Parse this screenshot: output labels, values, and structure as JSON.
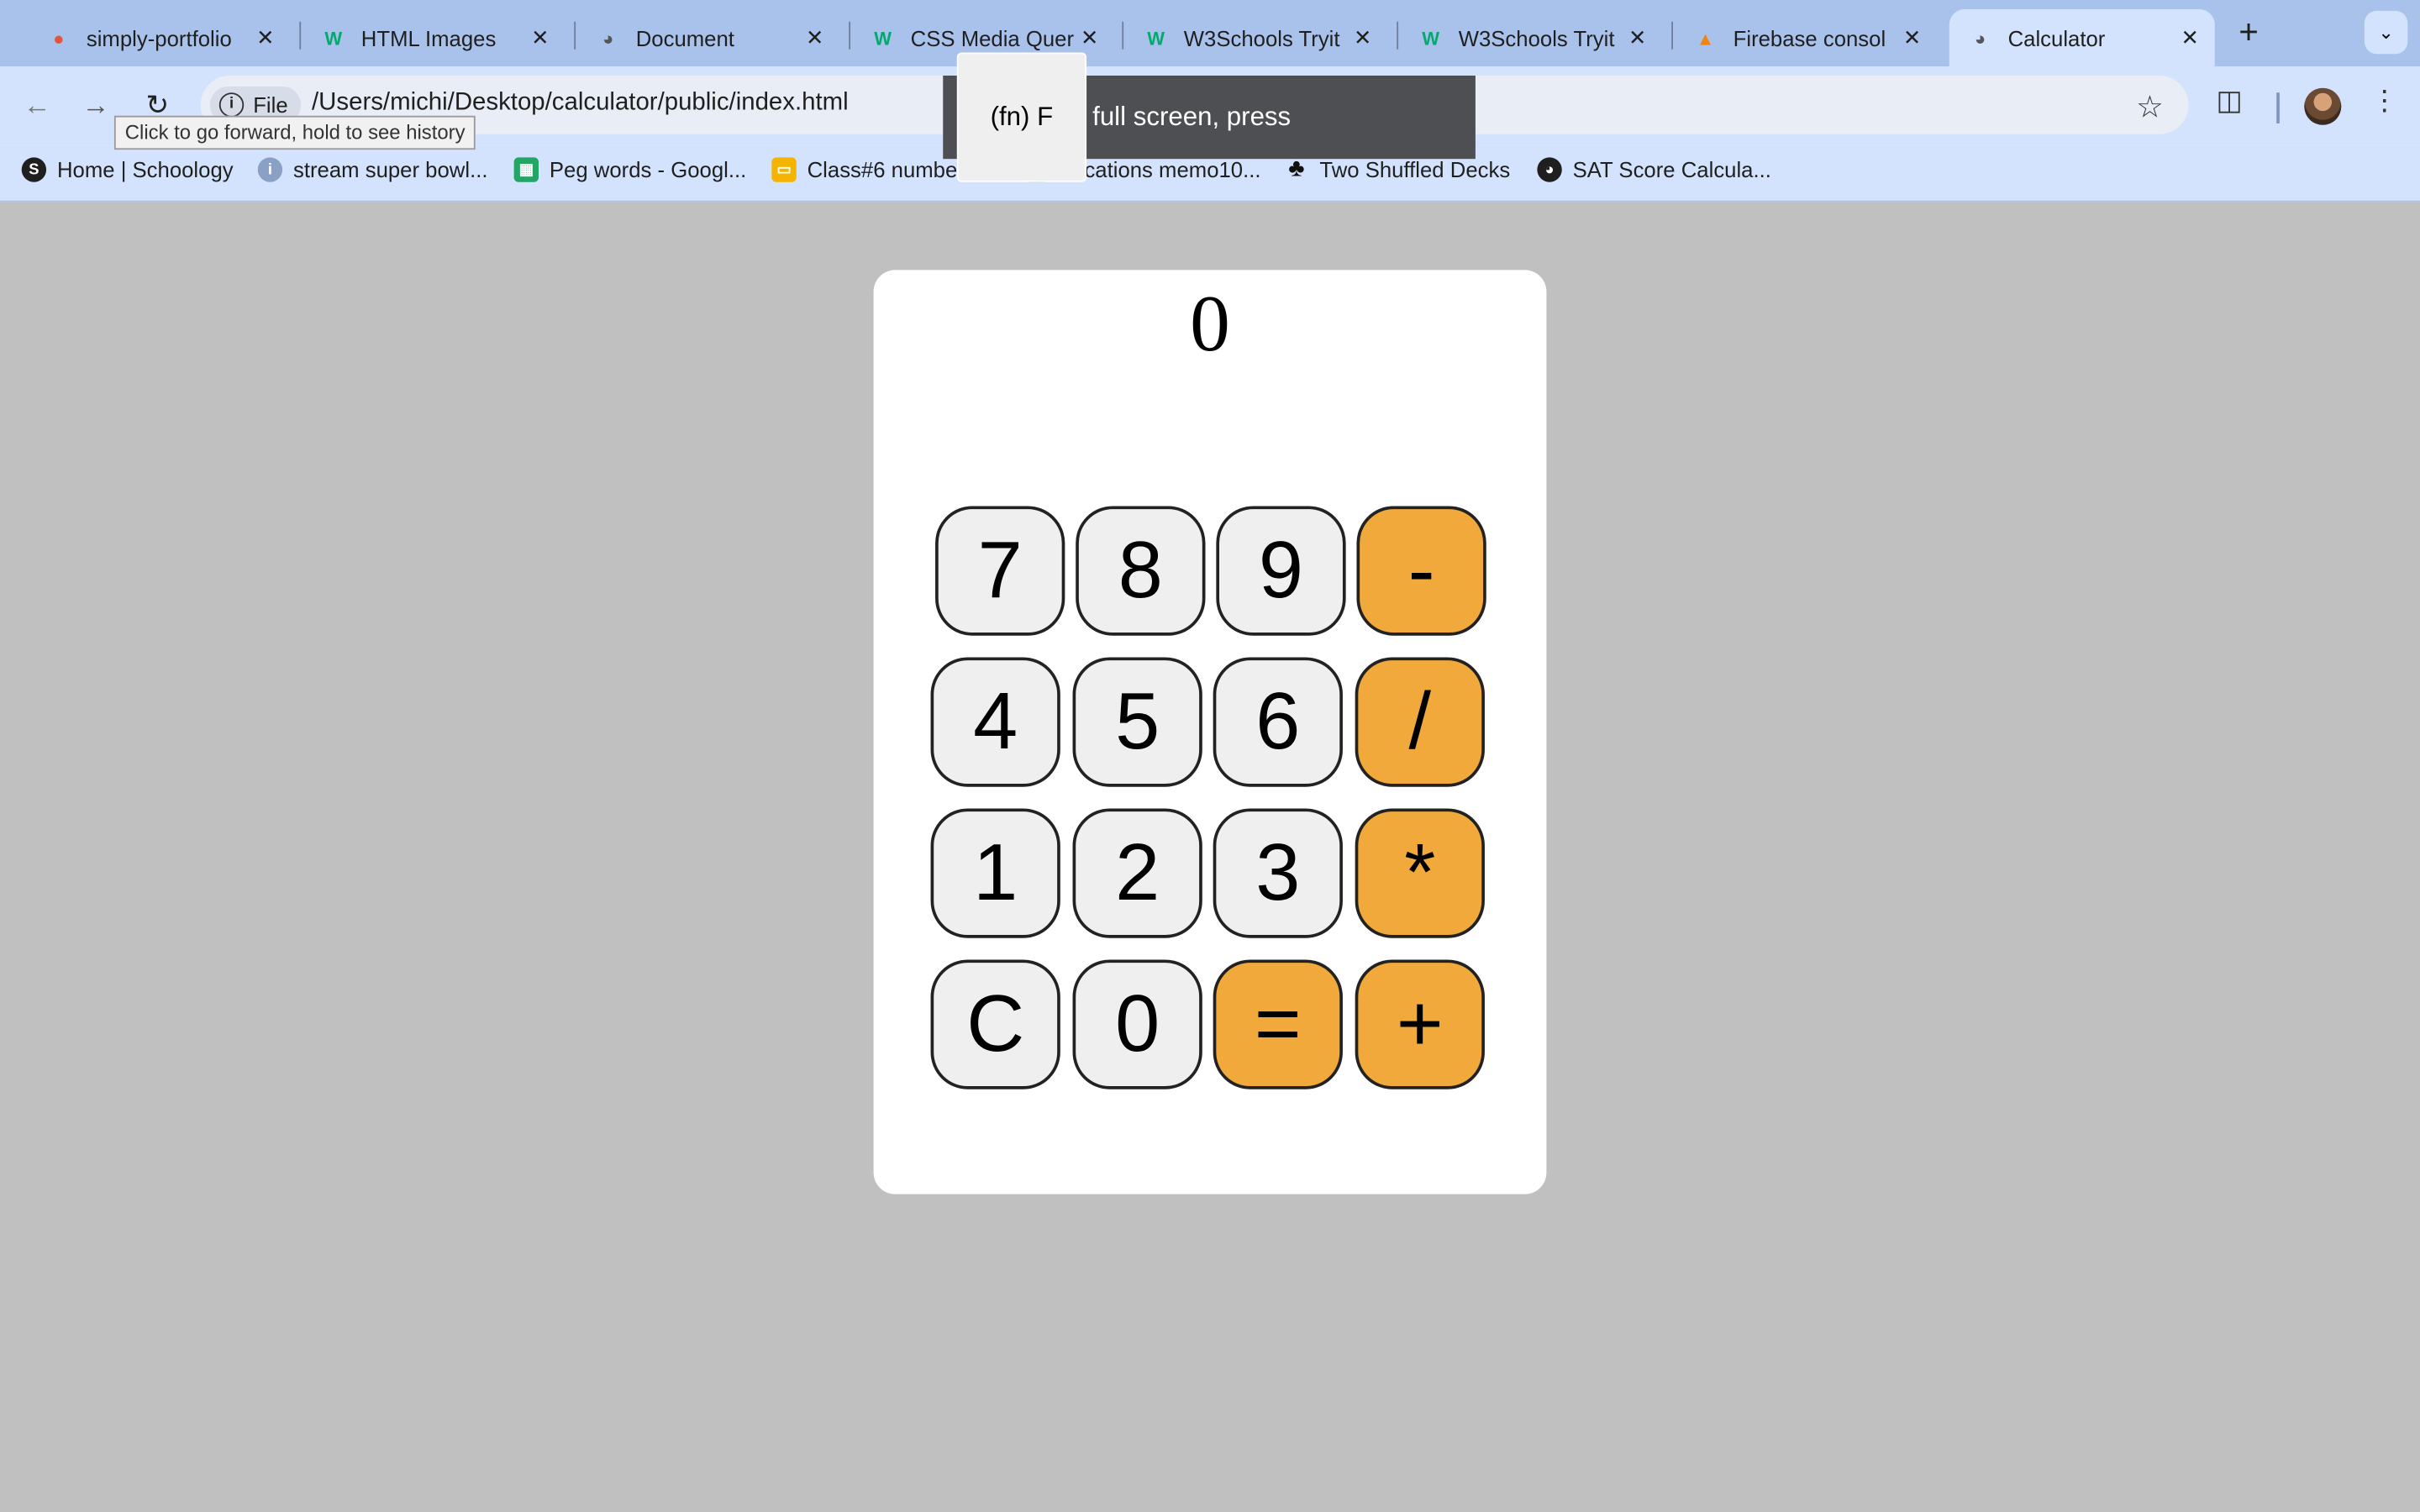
{
  "browser": {
    "tabs": [
      {
        "title": "simply-portfolio",
        "icon": "figma-icon"
      },
      {
        "title": "HTML Images",
        "icon": "w3schools-icon"
      },
      {
        "title": "Document",
        "icon": "globe-icon"
      },
      {
        "title": "CSS Media Quer",
        "icon": "w3schools-icon"
      },
      {
        "title": "W3Schools Tryit",
        "icon": "w3schools-icon"
      },
      {
        "title": "W3Schools Tryit",
        "icon": "w3schools-icon"
      },
      {
        "title": "Firebase consol",
        "icon": "firebase-icon"
      },
      {
        "title": "Calculator",
        "icon": "globe-icon",
        "active": true
      }
    ],
    "omnibox": {
      "chip_label": "File",
      "url": "/Users/michi/Desktop/calculator/public/index.html"
    },
    "tooltip": "Click to go forward, hold to see history",
    "fullscreen_toast": {
      "message": "To exit full screen, press",
      "key": "(fn) F"
    },
    "bookmarks": [
      {
        "label": "Home | Schoology",
        "icon": "schoology-icon"
      },
      {
        "label": "stream super bowl...",
        "icon": "info-icon"
      },
      {
        "label": "Peg words - Googl...",
        "icon": "sheets-icon"
      },
      {
        "label": "Class#6 numbers....",
        "icon": "slides-icon"
      },
      {
        "label": "Locations memo10...",
        "icon": "sheets-icon"
      },
      {
        "label": "Two Shuffled Decks",
        "icon": "club-icon"
      },
      {
        "label": "SAT Score Calcula...",
        "icon": "globe-icon"
      }
    ]
  },
  "calculator": {
    "display": "0",
    "keys": [
      "7",
      "8",
      "9",
      "-",
      "4",
      "5",
      "6",
      "/",
      "1",
      "2",
      "3",
      "*",
      "C",
      "0",
      "=",
      "+"
    ]
  },
  "colors": {
    "operator": "#f0a93a",
    "digit": "#efefef",
    "page_bg": "#c0c0c0"
  }
}
